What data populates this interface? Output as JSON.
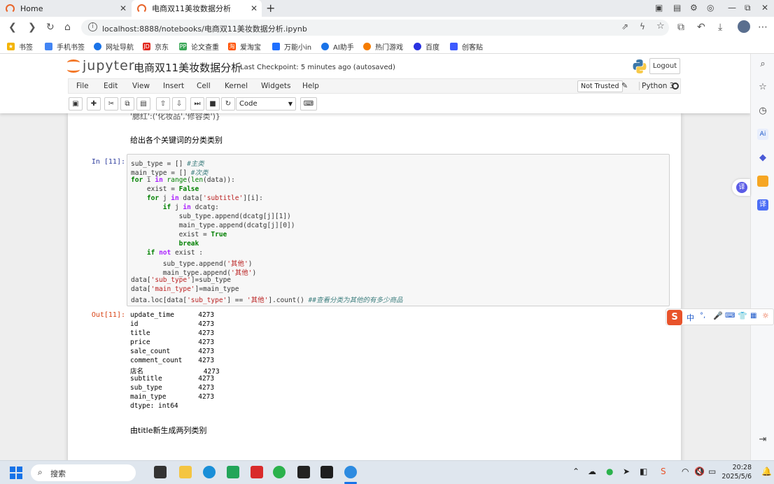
{
  "browser": {
    "tabs": [
      {
        "label": "Home"
      },
      {
        "label": "电商双11美妆数据分析"
      }
    ],
    "new_tab": "+",
    "window_controls": {
      "minimize": "—",
      "maximize": "⧉",
      "close": "✕"
    },
    "url": "localhost:8888/notebooks/电商双11美妆数据分析.ipynb",
    "bookmarks": [
      {
        "label": "书签",
        "color": "#f4b400"
      },
      {
        "label": "手机书签",
        "color": "#4285f4"
      },
      {
        "label": "网址导航",
        "color": "#1a73e8"
      },
      {
        "label": "京东",
        "color": "#e1251b",
        "badge": "JD"
      },
      {
        "label": "论文查重",
        "color": "#3aa757",
        "badge": "PP"
      },
      {
        "label": "爱淘宝",
        "color": "#ff5000",
        "badge": "淘"
      },
      {
        "label": "万能小in",
        "color": "#1e6fff"
      },
      {
        "label": "AI助手",
        "color": "#1a73e8"
      },
      {
        "label": "热门游戏",
        "color": "#f57c00"
      },
      {
        "label": "百度",
        "color": "#2932e1"
      },
      {
        "label": "创客贴",
        "color": "#3d5afe"
      }
    ]
  },
  "jupyter": {
    "logo_text": "jupyter",
    "notebook_name": "电商双11美妆数据分析",
    "checkpoint": "Last Checkpoint: 5 minutes ago  (autosaved)",
    "logout": "Logout",
    "menu": [
      "File",
      "Edit",
      "View",
      "Insert",
      "Cell",
      "Kernel",
      "Widgets",
      "Help"
    ],
    "trust_status": "Not Trusted",
    "kernel": "Python 3",
    "cell_type": "Code",
    "toolbar_icons": [
      "save-icon",
      "add-cell-icon",
      "cut-icon",
      "copy-icon",
      "paste-icon",
      "move-up-icon",
      "move-down-icon",
      "run-icon",
      "stop-icon",
      "restart-icon",
      "keyboard-icon"
    ]
  },
  "notebook": {
    "cut_text": "'腮红':('化妆品','修容类')}",
    "md1": "给出各个关键词的分类类别",
    "in_prompt": "In  [11]:",
    "out_prompt": "Out[11]:",
    "code_lines": [
      "sub_type = [] #主类",
      "main_type = [] #次类",
      "for i in range(len(data)):",
      "    exist = False",
      "    for j in data['subtitle'][i]:",
      "        if j in dcatg:",
      "            sub_type.append(dcatg[j][1])",
      "            main_type.append(dcatg[j][0])",
      "            exist = True",
      "            break",
      "    if not exist :",
      "        sub_type.append('其他')",
      "        main_type.append('其他')",
      "data['sub_type']=sub_type",
      "data['main_type']=main_type",
      "data.loc[data['sub_type'] == '其他'].count() ##查看分类为其他的有多少商品"
    ],
    "output_lines": [
      "update_time      4273",
      "id               4273",
      "title            4273",
      "price            4273",
      "sale_count       4273",
      "comment_count    4273",
      "店名               4273",
      "subtitle         4273",
      "sub_type         4273",
      "main_type        4273",
      "dtype: int64"
    ],
    "md2": "由title新生成两列类别"
  },
  "ime": {
    "logo": "S",
    "lang": "中"
  },
  "taskbar": {
    "search": "搜索",
    "time": "20:28",
    "date": "2025/5/6"
  }
}
